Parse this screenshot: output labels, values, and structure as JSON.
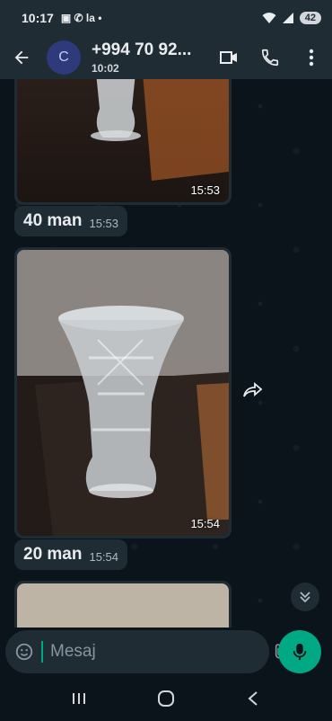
{
  "status_bar": {
    "time": "10:17",
    "notif": "▣ ✆ la •",
    "battery": "42"
  },
  "header": {
    "avatar_letter": "C",
    "contact_name": "+994 70 92...",
    "subtitle": "10:02"
  },
  "messages": [
    {
      "type": "image",
      "time": "15:53"
    },
    {
      "type": "text",
      "text": "40 man",
      "time": "15:53"
    },
    {
      "type": "image",
      "time": "15:54"
    },
    {
      "type": "text",
      "text": "20 man",
      "time": "15:54"
    },
    {
      "type": "image",
      "time": ""
    }
  ],
  "composer": {
    "placeholder": "Mesaj"
  },
  "icons": {
    "back": "arrow-left-icon",
    "video": "video-call-icon",
    "call": "phone-icon",
    "menu": "more-vertical-icon",
    "sticker": "sticker-icon",
    "attach": "paperclip-icon",
    "camera": "camera-icon",
    "mic": "microphone-icon",
    "forward": "forward-icon",
    "scroll": "double-chevron-down-icon"
  },
  "colors": {
    "accent": "#00a884",
    "bubble": "#1f2c34",
    "background": "#0b141a"
  }
}
